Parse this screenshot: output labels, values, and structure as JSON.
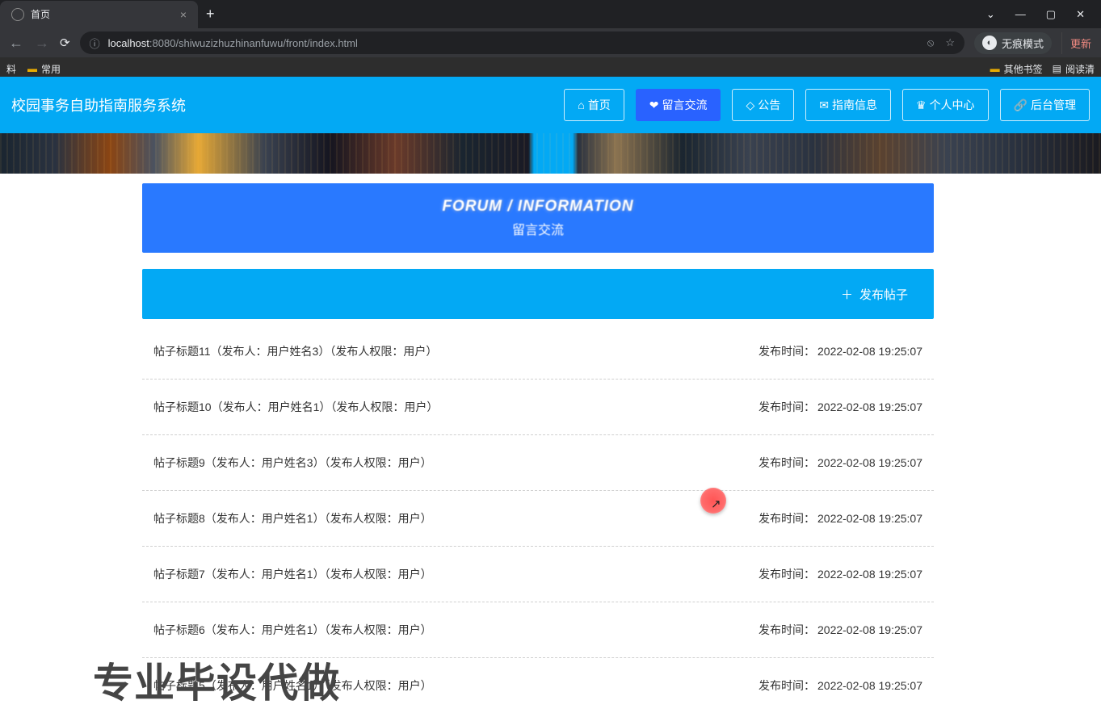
{
  "browser": {
    "tab_title": "首页",
    "url_host": "localhost",
    "url_path": ":8080/shiwuzizhuzhinanfuwu/front/index.html",
    "incognito_label": "无痕模式",
    "update_label": "更新",
    "bookmarks": {
      "item1": "料",
      "item2": "常用",
      "other_bookmarks": "其他书签",
      "reading_list": "阅读清"
    }
  },
  "site": {
    "title": "校园事务自助指南服务系统",
    "nav": {
      "home": "首页",
      "forum": "留言交流",
      "notice": "公告",
      "guide": "指南信息",
      "personal": "个人中心",
      "admin": "后台管理"
    }
  },
  "banner": {
    "title_en": "FORUM / INFORMATION",
    "title_cn": "留言交流"
  },
  "publish_btn": "发布帖子",
  "time_label": "发布时间：",
  "posts": [
    {
      "title": "帖子标题11（发布人：用户姓名3）（发布人权限：用户）",
      "time": "2022-02-08 19:25:07"
    },
    {
      "title": "帖子标题10（发布人：用户姓名1）（发布人权限：用户）",
      "time": "2022-02-08 19:25:07"
    },
    {
      "title": "帖子标题9（发布人：用户姓名3）（发布人权限：用户）",
      "time": "2022-02-08 19:25:07"
    },
    {
      "title": "帖子标题8（发布人：用户姓名1）（发布人权限：用户）",
      "time": "2022-02-08 19:25:07"
    },
    {
      "title": "帖子标题7（发布人：用户姓名1）（发布人权限：用户）",
      "time": "2022-02-08 19:25:07"
    },
    {
      "title": "帖子标题6（发布人：用户姓名1）（发布人权限：用户）",
      "time": "2022-02-08 19:25:07"
    },
    {
      "title": "帖子标题5（发布人：用户姓名1）（发布人权限：用户）",
      "time": "2022-02-08 19:25:07"
    }
  ],
  "watermark": "专业毕设代做"
}
